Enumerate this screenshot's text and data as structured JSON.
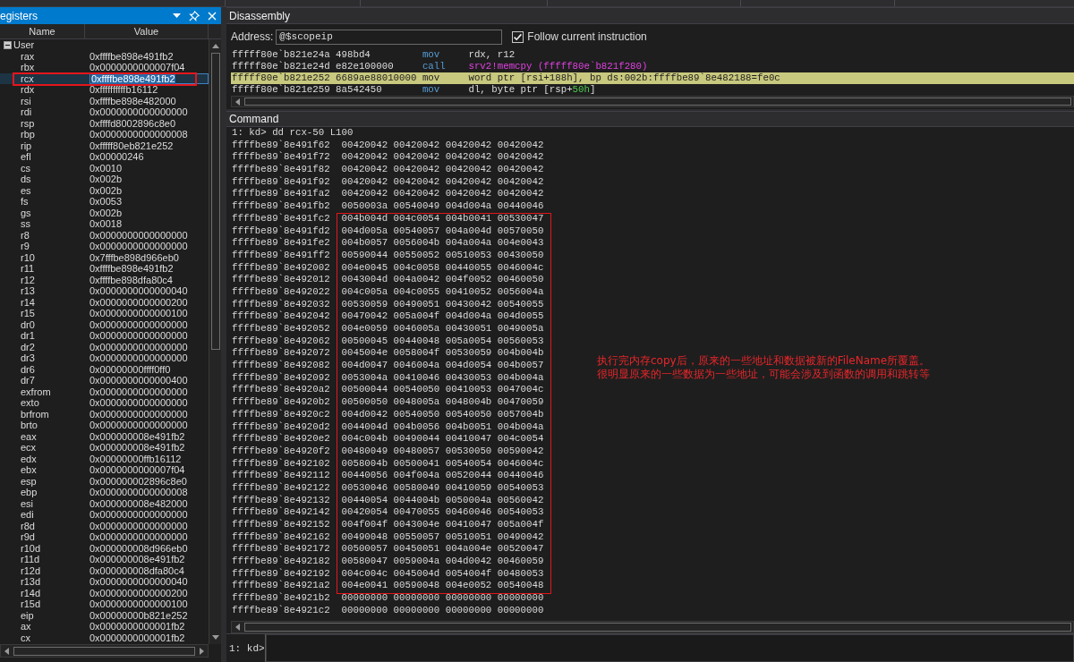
{
  "registers_panel": {
    "title": "egisters",
    "columns": [
      "Name",
      "Value"
    ],
    "tree": [
      {
        "label": "User",
        "expanded": true,
        "children": [
          {
            "name": "rax",
            "value": "0xffffbe898e491fb2",
            "selected": false,
            "boxed": false
          },
          {
            "name": "rbx",
            "value": "0x0000000000007f04",
            "selected": false,
            "boxed": false
          },
          {
            "name": "rcx",
            "value": "0xffffbe898e491fb2",
            "selected": true,
            "boxed": true
          },
          {
            "name": "rdx",
            "value": "0xffffffffffb16112",
            "selected": false,
            "boxed": false
          },
          {
            "name": "rsi",
            "value": "0xffffbe898e482000",
            "selected": false,
            "boxed": false
          },
          {
            "name": "rdi",
            "value": "0x0000000000000000",
            "selected": false,
            "boxed": false
          },
          {
            "name": "rsp",
            "value": "0xffffd8002896c8e0",
            "selected": false,
            "boxed": false
          },
          {
            "name": "rbp",
            "value": "0x0000000000000008",
            "selected": false,
            "boxed": false
          },
          {
            "name": "rip",
            "value": "0xfffff80eb821e252",
            "selected": false,
            "boxed": false
          },
          {
            "name": "efl",
            "value": "0x00000246",
            "selected": false,
            "boxed": false
          },
          {
            "name": "cs",
            "value": "0x0010",
            "selected": false,
            "boxed": false
          },
          {
            "name": "ds",
            "value": "0x002b",
            "selected": false,
            "boxed": false
          },
          {
            "name": "es",
            "value": "0x002b",
            "selected": false,
            "boxed": false
          },
          {
            "name": "fs",
            "value": "0x0053",
            "selected": false,
            "boxed": false
          },
          {
            "name": "gs",
            "value": "0x002b",
            "selected": false,
            "boxed": false
          },
          {
            "name": "ss",
            "value": "0x0018",
            "selected": false,
            "boxed": false
          },
          {
            "name": "r8",
            "value": "0x0000000000000000",
            "selected": false,
            "boxed": false
          },
          {
            "name": "r9",
            "value": "0x0000000000000000",
            "selected": false,
            "boxed": false
          },
          {
            "name": "r10",
            "value": "0x7fffbe898d966eb0",
            "selected": false,
            "boxed": false
          },
          {
            "name": "r11",
            "value": "0xffffbe898e491fb2",
            "selected": false,
            "boxed": false
          },
          {
            "name": "r12",
            "value": "0xffffbe898dfa80c4",
            "selected": false,
            "boxed": false
          },
          {
            "name": "r13",
            "value": "0x0000000000000040",
            "selected": false,
            "boxed": false
          },
          {
            "name": "r14",
            "value": "0x0000000000000200",
            "selected": false,
            "boxed": false
          },
          {
            "name": "r15",
            "value": "0x0000000000000100",
            "selected": false,
            "boxed": false
          },
          {
            "name": "dr0",
            "value": "0x0000000000000000",
            "selected": false,
            "boxed": false
          },
          {
            "name": "dr1",
            "value": "0x0000000000000000",
            "selected": false,
            "boxed": false
          },
          {
            "name": "dr2",
            "value": "0x0000000000000000",
            "selected": false,
            "boxed": false
          },
          {
            "name": "dr3",
            "value": "0x0000000000000000",
            "selected": false,
            "boxed": false
          },
          {
            "name": "dr6",
            "value": "0x00000000ffff0ff0",
            "selected": false,
            "boxed": false
          },
          {
            "name": "dr7",
            "value": "0x0000000000000400",
            "selected": false,
            "boxed": false
          },
          {
            "name": "exfrom",
            "value": "0x0000000000000000",
            "selected": false,
            "boxed": false
          },
          {
            "name": "exto",
            "value": "0x0000000000000000",
            "selected": false,
            "boxed": false
          },
          {
            "name": "brfrom",
            "value": "0x0000000000000000",
            "selected": false,
            "boxed": false
          },
          {
            "name": "brto",
            "value": "0x0000000000000000",
            "selected": false,
            "boxed": false
          },
          {
            "name": "eax",
            "value": "0x000000008e491fb2",
            "selected": false,
            "boxed": false
          },
          {
            "name": "ecx",
            "value": "0x000000008e491fb2",
            "selected": false,
            "boxed": false
          },
          {
            "name": "edx",
            "value": "0x00000000ffb16112",
            "selected": false,
            "boxed": false
          },
          {
            "name": "ebx",
            "value": "0x0000000000007f04",
            "selected": false,
            "boxed": false
          },
          {
            "name": "esp",
            "value": "0x000000002896c8e0",
            "selected": false,
            "boxed": false
          },
          {
            "name": "ebp",
            "value": "0x0000000000000008",
            "selected": false,
            "boxed": false
          },
          {
            "name": "esi",
            "value": "0x000000008e482000",
            "selected": false,
            "boxed": false
          },
          {
            "name": "edi",
            "value": "0x0000000000000000",
            "selected": false,
            "boxed": false
          },
          {
            "name": "r8d",
            "value": "0x0000000000000000",
            "selected": false,
            "boxed": false
          },
          {
            "name": "r9d",
            "value": "0x0000000000000000",
            "selected": false,
            "boxed": false
          },
          {
            "name": "r10d",
            "value": "0x000000008d966eb0",
            "selected": false,
            "boxed": false
          },
          {
            "name": "r11d",
            "value": "0x000000008e491fb2",
            "selected": false,
            "boxed": false
          },
          {
            "name": "r12d",
            "value": "0x000000008dfa80c4",
            "selected": false,
            "boxed": false
          },
          {
            "name": "r13d",
            "value": "0x0000000000000040",
            "selected": false,
            "boxed": false
          },
          {
            "name": "r14d",
            "value": "0x0000000000000200",
            "selected": false,
            "boxed": false
          },
          {
            "name": "r15d",
            "value": "0x0000000000000100",
            "selected": false,
            "boxed": false
          },
          {
            "name": "eip",
            "value": "0x00000000b821e252",
            "selected": false,
            "boxed": false
          },
          {
            "name": "ax",
            "value": "0x0000000000001fb2",
            "selected": false,
            "boxed": false
          },
          {
            "name": "cx",
            "value": "0x0000000000001fb2",
            "selected": false,
            "boxed": false
          }
        ]
      }
    ]
  },
  "disassembly_panel": {
    "title": "Disassembly",
    "address_label": "Address:",
    "address_value": "@$scopeip",
    "follow": {
      "label": "Follow current instruction",
      "checked": true
    },
    "lines": [
      {
        "address": "fffff80e`b821e24a",
        "bytes": "498bd4",
        "mnemonic": "mov",
        "operands": [
          {
            "text": "rdx, r12",
            "kind": "plain"
          }
        ],
        "current": false
      },
      {
        "address": "fffff80e`b821e24d",
        "bytes": "e82e100000",
        "mnemonic": "call",
        "operands": [
          {
            "text": "srv2!memcpy (fffff80e`b821f280)",
            "kind": "symbol"
          }
        ],
        "current": false
      },
      {
        "address": "fffff80e`b821e252",
        "bytes": "6689ae88010000",
        "mnemonic": "mov",
        "operands": [
          {
            "text": "word ptr [rsi+188h], bp ds:002b:ffffbe89`8e482188=fe0c",
            "kind": "plain"
          }
        ],
        "current": true
      },
      {
        "address": "fffff80e`b821e259",
        "bytes": "8a542450",
        "mnemonic": "mov",
        "operands": [
          {
            "text": "dl, byte ptr [rsp+",
            "kind": "plain"
          },
          {
            "text": "50h",
            "kind": "number"
          },
          {
            "text": "]",
            "kind": "plain"
          }
        ],
        "current": false
      }
    ]
  },
  "command_panel": {
    "title": "Command",
    "command_line": "1: kd> dd rcx-50 L100",
    "output": [
      {
        "boxed": false,
        "lines": [
          {
            "address": "ffffbe89`8e491f62",
            "data": "00420042 00420042 00420042 00420042"
          },
          {
            "address": "ffffbe89`8e491f72",
            "data": "00420042 00420042 00420042 00420042"
          },
          {
            "address": "ffffbe89`8e491f82",
            "data": "00420042 00420042 00420042 00420042"
          },
          {
            "address": "ffffbe89`8e491f92",
            "data": "00420042 00420042 00420042 00420042"
          },
          {
            "address": "ffffbe89`8e491fa2",
            "data": "00420042 00420042 00420042 00420042"
          },
          {
            "address": "ffffbe89`8e491fb2",
            "data": "0050003a 00540049 004d004a 00440046"
          }
        ]
      },
      {
        "boxed": true,
        "lines": [
          {
            "address": "ffffbe89`8e491fc2",
            "data": "004b004d 004c0054 004b0041 00530047"
          },
          {
            "address": "ffffbe89`8e491fd2",
            "data": "004d005a 00540057 004a004d 00570050"
          },
          {
            "address": "ffffbe89`8e491fe2",
            "data": "004b0057 0056004b 004a004a 004e0043"
          },
          {
            "address": "ffffbe89`8e491ff2",
            "data": "00590044 00550052 00510053 00430050"
          },
          {
            "address": "ffffbe89`8e492002",
            "data": "004e0045 004c0058 00440055 0046004c"
          },
          {
            "address": "ffffbe89`8e492012",
            "data": "0043004d 004a0042 004f0052 00460050"
          },
          {
            "address": "ffffbe89`8e492022",
            "data": "004c005a 004c0055 00410052 0056004a"
          },
          {
            "address": "ffffbe89`8e492032",
            "data": "00530059 00490051 00430042 00540055"
          },
          {
            "address": "ffffbe89`8e492042",
            "data": "00470042 005a004f 004d004a 004d0055"
          },
          {
            "address": "ffffbe89`8e492052",
            "data": "004e0059 0046005a 00430051 0049005a"
          },
          {
            "address": "ffffbe89`8e492062",
            "data": "00500045 00440048 005a0054 00560053"
          },
          {
            "address": "ffffbe89`8e492072",
            "data": "0045004e 0058004f 00530059 004b004b"
          },
          {
            "address": "ffffbe89`8e492082",
            "data": "004d0047 0046004a 004d0054 004b0057"
          },
          {
            "address": "ffffbe89`8e492092",
            "data": "0053004a 00410046 00430053 004b004a"
          },
          {
            "address": "ffffbe89`8e4920a2",
            "data": "00500044 00540050 00410053 0047004c"
          },
          {
            "address": "ffffbe89`8e4920b2",
            "data": "00500050 0048005a 0048004b 00470059"
          },
          {
            "address": "ffffbe89`8e4920c2",
            "data": "004d0042 00540050 00540050 0057004b"
          },
          {
            "address": "ffffbe89`8e4920d2",
            "data": "0044004d 004b0056 004b0051 004b004a"
          },
          {
            "address": "ffffbe89`8e4920e2",
            "data": "004c004b 00490044 00410047 004c0054"
          },
          {
            "address": "ffffbe89`8e4920f2",
            "data": "00480049 00480057 00530050 00590042"
          },
          {
            "address": "ffffbe89`8e492102",
            "data": "0058004b 00500041 00540054 0046004c"
          },
          {
            "address": "ffffbe89`8e492112",
            "data": "00440056 004f004a 00520044 00440046"
          },
          {
            "address": "ffffbe89`8e492122",
            "data": "00530046 00580049 00410059 00540053"
          },
          {
            "address": "ffffbe89`8e492132",
            "data": "00440054 0044004b 0050004a 00560042"
          },
          {
            "address": "ffffbe89`8e492142",
            "data": "00420054 00470055 00460046 00540053"
          },
          {
            "address": "ffffbe89`8e492152",
            "data": "004f004f 0043004e 00410047 005a004f"
          },
          {
            "address": "ffffbe89`8e492162",
            "data": "00490048 00550057 00510051 00490042"
          },
          {
            "address": "ffffbe89`8e492172",
            "data": "00500057 00450051 004a004e 00520047"
          },
          {
            "address": "ffffbe89`8e492182",
            "data": "00580047 0059004a 004d0042 00460059"
          },
          {
            "address": "ffffbe89`8e492192",
            "data": "004c004c 0045004d 0054004f 00480053"
          },
          {
            "address": "ffffbe89`8e4921a2",
            "data": "004e0041 00590048 004e0052 00540048"
          }
        ]
      },
      {
        "boxed": false,
        "lines": [
          {
            "address": "ffffbe89`8e4921b2",
            "data": "00000000 00000000 00000000 00000000"
          },
          {
            "address": "ffffbe89`8e4921c2",
            "data": "00000000 00000000 00000000 00000000"
          }
        ]
      }
    ],
    "note": [
      "执行完内存copy后，原来的一些地址和数据被新的FileName所覆盖。",
      "很明显原来的一些数据为一些地址，可能会涉及到函数的调用和跳转等"
    ],
    "prompt": "1: kd>"
  }
}
